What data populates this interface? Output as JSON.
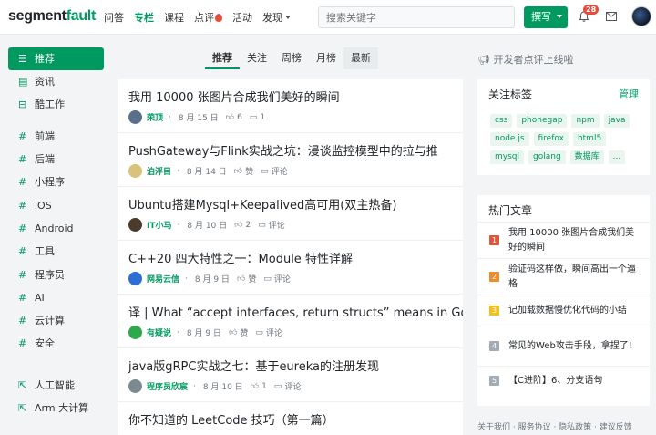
{
  "header": {
    "logo_main": "segment",
    "logo_accent": "fault",
    "nav": [
      "问答",
      "专栏",
      "课程",
      "点评",
      "活动",
      "发现"
    ],
    "search_placeholder": "搜索关键字",
    "write_label": "撰写",
    "notification_count": "28",
    "colors": {
      "brand": "#009a61",
      "badge": "#e74c3c"
    }
  },
  "sidebar": {
    "items": [
      {
        "icon": "list-icon",
        "label": "推荐"
      },
      {
        "icon": "news-icon",
        "label": "资讯"
      },
      {
        "icon": "briefcase-icon",
        "label": "酷工作"
      },
      {
        "icon": "hash-icon",
        "label": "前端"
      },
      {
        "icon": "hash-icon",
        "label": "后端"
      },
      {
        "icon": "hash-icon",
        "label": "小程序"
      },
      {
        "icon": "hash-icon",
        "label": "iOS"
      },
      {
        "icon": "hash-icon",
        "label": "Android"
      },
      {
        "icon": "hash-icon",
        "label": "工具"
      },
      {
        "icon": "hash-icon",
        "label": "程序员"
      },
      {
        "icon": "hash-icon",
        "label": "AI"
      },
      {
        "icon": "hash-icon",
        "label": "云计算"
      },
      {
        "icon": "hash-icon",
        "label": "安全"
      },
      {
        "icon": "external-link-icon",
        "label": "人工智能"
      },
      {
        "icon": "external-link-icon",
        "label": "Arm 大计算"
      }
    ]
  },
  "feed_tabs": [
    "推荐",
    "关注",
    "周榜",
    "月榜",
    "最新"
  ],
  "announcement": "开发者点评上线啦",
  "feed": [
    {
      "title": "我用 10000 张图片合成我们美好的瞬间",
      "author": "荣顶",
      "date": "8 月 15 日",
      "likes": "6",
      "comments": "1",
      "avatar_color": "#5a6f8c"
    },
    {
      "title": "PushGateway与Flink实战之坑：漫谈监控模型中的拉与推",
      "author": "泊浮目",
      "date": "8 月 14 日",
      "likes": "赞",
      "comments": "评论",
      "avatar_color": "#d9c27a"
    },
    {
      "title": "Ubuntu搭建Mysql+Keepalived高可用(双主热备)",
      "author": "IT小马",
      "date": "8 月 10 日",
      "likes": "2",
      "comments": "评论",
      "avatar_color": "#4a3b2a"
    },
    {
      "title": "C++20 四大特性之一：Module 特性详解",
      "author": "网易云信",
      "date": "8 月 9 日",
      "likes": "赞",
      "comments": "评论",
      "avatar_color": "#2b6fd6"
    },
    {
      "title": "译 | What “accept interfaces, return structs” means in Go",
      "author": "有疑说",
      "date": "8 月 9 日",
      "likes": "赞",
      "comments": "评论",
      "avatar_color": "#2ea84a"
    },
    {
      "title": "java版gRPC实战之七：基于eureka的注册发现",
      "author": "程序员欣宸",
      "date": "8 月 10 日",
      "likes": "1",
      "comments": "评论",
      "avatar_color": "#7a8a90"
    },
    {
      "title": "你不知道的 LeetCode 技巧（第一篇）",
      "author": "",
      "date": "",
      "likes": "",
      "comments": "",
      "avatar_color": "#cccccc"
    }
  ],
  "tags_card": {
    "title": "关注标签",
    "manage": "管理",
    "tags": [
      "css",
      "phonegap",
      "npm",
      "java",
      "node.js",
      "firefox",
      "html5",
      "mysql",
      "golang",
      "数据库",
      "..."
    ]
  },
  "hot_card": {
    "title": "热门文章",
    "items": [
      {
        "rank": "1",
        "text": "我用 10000 张图片合成我们美好的瞬间",
        "color": "#e0543b"
      },
      {
        "rank": "2",
        "text": "验证码这样做，瞬间高出一个逼格",
        "color": "#f2892a"
      },
      {
        "rank": "3",
        "text": "记加载数据慢优化代码的小结",
        "color": "#f3c01f"
      },
      {
        "rank": "4",
        "text": "常见的Web攻击手段，拿捏了!",
        "color": "#a3acb5"
      },
      {
        "rank": "5",
        "text": "【C进阶】6、分支语句",
        "color": "#a3acb5"
      }
    ]
  },
  "footer": "关于我们 · 服务协议 · 隐私政策 · 建议反馈"
}
